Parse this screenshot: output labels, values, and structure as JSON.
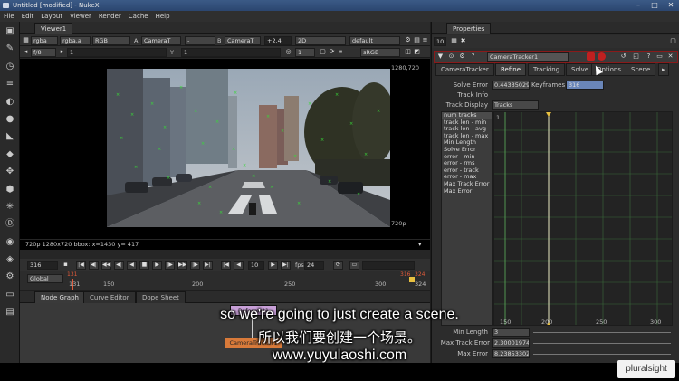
{
  "titlebar": {
    "title": "Untitled [modified] - NukeX",
    "min": "–",
    "max": "□",
    "close": "✕"
  },
  "menu": [
    "File",
    "Edit",
    "Layout",
    "Viewer",
    "Render",
    "Cache",
    "Help"
  ],
  "left_tools": [
    "image-icon",
    "draw-icon",
    "time-icon",
    "channel-icon",
    "color-icon",
    "filter-icon",
    "keyer-icon",
    "merge-icon",
    "transform-icon",
    "3d-icon",
    "particles-icon",
    "deep-icon",
    "views-icon",
    "metadata-icon",
    "toolsets-icon",
    "other-icon",
    "furnace-icon"
  ],
  "viewer": {
    "tab": "Viewer1",
    "row1": {
      "channels": "rgba",
      "alpha": "rgba.a",
      "colorspace": "RGB",
      "a_label": "A",
      "a_input": "CameraT",
      "dash": "-",
      "b_label": "B",
      "b_input": "CameraT",
      "gain": "+2.4",
      "mode": "2D",
      "lut": "default"
    },
    "row2": {
      "f_stop": "f/8",
      "frame": "1",
      "y_label": "Y",
      "y_value": "1",
      "zoom": "1",
      "lut2": "sRGB"
    },
    "coord_top": "1280,720",
    "coord_bottom": "720p",
    "info": "720p 1280x720 bbox:   x=1430 y= 417"
  },
  "timeline": {
    "frame": "316",
    "step": "10",
    "fps_label": "fps",
    "fps": "24",
    "range_mode": "Global",
    "ticks": [
      "131",
      "150",
      "200",
      "250",
      "300",
      "324"
    ],
    "red_marks": [
      "131",
      "316",
      "324"
    ]
  },
  "nodegraph": {
    "tabs": [
      "Node Graph",
      "Curve Editor",
      "Dope Sheet"
    ],
    "node_top": "Reformat1",
    "node_bottom": "CameraTracker1"
  },
  "properties": {
    "title": "Properties",
    "count": "10",
    "node_name": "CameraTracker1",
    "tabs": [
      "CameraTracker",
      "Refine",
      "Tracking",
      "Solve",
      "Options",
      "Scene"
    ],
    "solve_error_label": "Solve Error",
    "solve_error": "0.44335029",
    "keyframes_label": "Keyframes",
    "keyframes": "316",
    "track_info_label": "Track Info",
    "track_display_label": "Track Display",
    "track_display": "Tracks",
    "curves": [
      "num tracks",
      "track len - min",
      "track len - avg",
      "track len - max",
      "Min Length",
      "Solve Error",
      "error - min",
      "error - rms",
      "error - track",
      "error - max",
      "Max Track Error",
      "Max Error"
    ],
    "graph_ticks": [
      "150",
      "200",
      "250",
      "300"
    ],
    "graph_y_label": "1",
    "min_length_label": "Min Length",
    "min_length": "3",
    "max_track_error_label": "Max Track Error",
    "max_track_error": "2.30001974",
    "max_error_label": "Max Error",
    "max_error": "8.23853302"
  },
  "subtitles": {
    "en": "so we're going to just create a scene.",
    "zh": "所以我们要创建一个场景。",
    "url": "www.yuyulaoshi.com"
  },
  "watermark": "pluralsight",
  "colors": {
    "accent_red": "#c02020",
    "track_green": "#38d838",
    "graph_green": "#3a6a3a"
  }
}
